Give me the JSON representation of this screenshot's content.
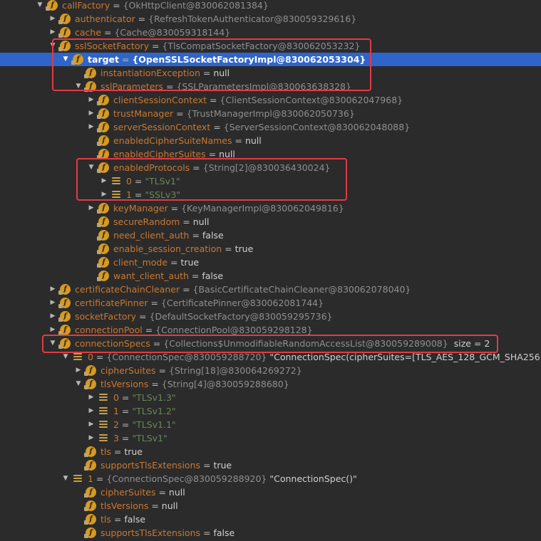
{
  "rows": [
    {
      "depth": 0,
      "expander": "down",
      "icon": "field",
      "name": "callFactory",
      "eq": " = ",
      "meta": "{OkHttpClient@830062081384}"
    },
    {
      "depth": 1,
      "expander": "right",
      "icon": "field",
      "name": "authenticator",
      "eq": " = ",
      "meta": "{RefreshTokenAuthenticator@830059329616}"
    },
    {
      "depth": 1,
      "expander": "right",
      "icon": "field",
      "name": "cache",
      "eq": " = ",
      "meta": "{Cache@830059318144}"
    },
    {
      "depth": 1,
      "expander": "down",
      "icon": "field",
      "name": "sslSocketFactory",
      "eq": " = ",
      "meta": "{TlsCompatSocketFactory@830062053232}"
    },
    {
      "depth": 2,
      "expander": "down",
      "icon": "field",
      "name": "target",
      "eq": " = ",
      "meta": "{OpenSSLSocketFactoryImpl@830062053304}",
      "selected": true
    },
    {
      "depth": 3,
      "expander": "none",
      "icon": "field",
      "name": "instantiationException",
      "eq": " = ",
      "value": "null"
    },
    {
      "depth": 3,
      "expander": "down",
      "icon": "field",
      "name": "sslParameters",
      "eq": " = ",
      "meta": "{SSLParametersImpl@830063638328}"
    },
    {
      "depth": 4,
      "expander": "right",
      "icon": "field",
      "name": "clientSessionContext",
      "eq": " = ",
      "meta": "{ClientSessionContext@830062047968}"
    },
    {
      "depth": 4,
      "expander": "right",
      "icon": "field",
      "name": "trustManager",
      "eq": " = ",
      "meta": "{TrustManagerImpl@830062050736}"
    },
    {
      "depth": 4,
      "expander": "right",
      "icon": "field",
      "name": "serverSessionContext",
      "eq": " = ",
      "meta": "{ServerSessionContext@830062048088}"
    },
    {
      "depth": 4,
      "expander": "none",
      "icon": "field",
      "name": "enabledCipherSuiteNames",
      "eq": " = ",
      "value": "null"
    },
    {
      "depth": 4,
      "expander": "none",
      "icon": "field",
      "name": "enabledCipherSuites",
      "eq": " = ",
      "value": "null"
    },
    {
      "depth": 4,
      "expander": "down",
      "icon": "field",
      "name": "enabledProtocols",
      "eq": " = ",
      "meta": "{String[2]@830036430024}"
    },
    {
      "depth": 5,
      "expander": "right",
      "icon": "array",
      "name": "0",
      "eq": " = ",
      "str": "\"TLSv1\""
    },
    {
      "depth": 5,
      "expander": "right",
      "icon": "array",
      "name": "1",
      "eq": " = ",
      "str": "\"SSLv3\""
    },
    {
      "depth": 4,
      "expander": "right",
      "icon": "field",
      "name": "keyManager",
      "eq": " = ",
      "meta": "{KeyManagerImpl@830062049816}"
    },
    {
      "depth": 4,
      "expander": "none",
      "icon": "field",
      "name": "secureRandom",
      "eq": " = ",
      "value": "null"
    },
    {
      "depth": 4,
      "expander": "none",
      "icon": "field",
      "name": "need_client_auth",
      "eq": " = ",
      "value": "false"
    },
    {
      "depth": 4,
      "expander": "none",
      "icon": "field",
      "name": "enable_session_creation",
      "eq": " = ",
      "value": "true"
    },
    {
      "depth": 4,
      "expander": "none",
      "icon": "field",
      "name": "client_mode",
      "eq": " = ",
      "value": "true"
    },
    {
      "depth": 4,
      "expander": "none",
      "icon": "field",
      "name": "want_client_auth",
      "eq": " = ",
      "value": "false"
    },
    {
      "depth": 1,
      "expander": "right",
      "icon": "field",
      "name": "certificateChainCleaner",
      "eq": " = ",
      "meta": "{BasicCertificateChainCleaner@830062078040}"
    },
    {
      "depth": 1,
      "expander": "right",
      "icon": "field",
      "name": "certificatePinner",
      "eq": " = ",
      "meta": "{CertificatePinner@830062081744}"
    },
    {
      "depth": 1,
      "expander": "right",
      "icon": "field",
      "name": "socketFactory",
      "eq": " = ",
      "meta": "{DefaultSocketFactory@830059295736}"
    },
    {
      "depth": 1,
      "expander": "right",
      "icon": "field",
      "name": "connectionPool",
      "eq": " = ",
      "meta": "{ConnectionPool@830059298128}"
    },
    {
      "depth": 1,
      "expander": "down",
      "icon": "field",
      "name": "connectionSpecs",
      "eq": " = ",
      "meta": "{Collections$UnmodifiableRandomAccessList@830059289008}",
      "size": "size = 2"
    },
    {
      "depth": 2,
      "expander": "down",
      "icon": "array",
      "name": "0",
      "eq": " = ",
      "meta": "{ConnectionSpec@830059288720}",
      "value": " \"ConnectionSpec(cipherSuites=[TLS_AES_128_GCM_SHA256..."
    },
    {
      "depth": 3,
      "expander": "right",
      "icon": "field",
      "name": "cipherSuites",
      "eq": " = ",
      "meta": "{String[18]@830064269272}"
    },
    {
      "depth": 3,
      "expander": "down",
      "icon": "field",
      "name": "tlsVersions",
      "eq": " = ",
      "meta": "{String[4]@830059288680}"
    },
    {
      "depth": 4,
      "expander": "right",
      "icon": "array",
      "name": "0",
      "eq": " = ",
      "str": "\"TLSv1.3\""
    },
    {
      "depth": 4,
      "expander": "right",
      "icon": "array",
      "name": "1",
      "eq": " = ",
      "str": "\"TLSv1.2\""
    },
    {
      "depth": 4,
      "expander": "right",
      "icon": "array",
      "name": "2",
      "eq": " = ",
      "str": "\"TLSv1.1\""
    },
    {
      "depth": 4,
      "expander": "right",
      "icon": "array",
      "name": "3",
      "eq": " = ",
      "str": "\"TLSv1\""
    },
    {
      "depth": 3,
      "expander": "none",
      "icon": "field",
      "name": "tls",
      "eq": " = ",
      "value": "true"
    },
    {
      "depth": 3,
      "expander": "none",
      "icon": "field",
      "name": "supportsTlsExtensions",
      "eq": " = ",
      "value": "true"
    },
    {
      "depth": 2,
      "expander": "down",
      "icon": "array",
      "name": "1",
      "eq": " = ",
      "meta": "{ConnectionSpec@830059288920}",
      "value": " \"ConnectionSpec()\""
    },
    {
      "depth": 3,
      "expander": "none",
      "icon": "field",
      "name": "cipherSuites",
      "eq": " = ",
      "value": "null"
    },
    {
      "depth": 3,
      "expander": "none",
      "icon": "field",
      "name": "tlsVersions",
      "eq": " = ",
      "value": "null"
    },
    {
      "depth": 3,
      "expander": "none",
      "icon": "field",
      "name": "tls",
      "eq": " = ",
      "value": "false"
    },
    {
      "depth": 3,
      "expander": "none",
      "icon": "field",
      "name": "supportsTlsExtensions",
      "eq": " = ",
      "value": "false"
    }
  ],
  "colors": {
    "background": "#2b2b2b",
    "selection": "#2f65ca",
    "field_name": "#ca7832",
    "string_value": "#6a8759",
    "highlight_box": "#e23a46"
  },
  "expander_glyphs": {
    "down": "▼",
    "right": "▶",
    "none": ""
  },
  "icon_names": {
    "field": "field-icon",
    "array": "array-element-icon"
  }
}
